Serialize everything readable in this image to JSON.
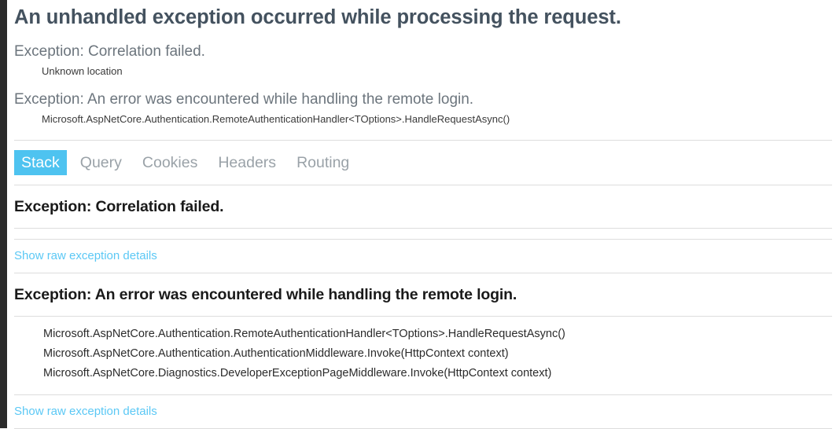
{
  "page": {
    "title": "An unhandled exception occurred while processing the request."
  },
  "header": {
    "summaries": [
      {
        "text": "Exception: Correlation failed.",
        "location": "Unknown location"
      },
      {
        "text": "Exception: An error was encountered while handling the remote login.",
        "location": "Microsoft.AspNetCore.Authentication.RemoteAuthenticationHandler<TOptions>.HandleRequestAsync()"
      }
    ]
  },
  "tabs": {
    "items": [
      {
        "label": "Stack",
        "active": true
      },
      {
        "label": "Query",
        "active": false
      },
      {
        "label": "Cookies",
        "active": false
      },
      {
        "label": "Headers",
        "active": false
      },
      {
        "label": "Routing",
        "active": false
      }
    ]
  },
  "stack": {
    "sections": [
      {
        "title": "Exception: Correlation failed.",
        "frames": [],
        "raw_details_label": "Show raw exception details"
      },
      {
        "title": "Exception: An error was encountered while handling the remote login.",
        "frames": [
          "Microsoft.AspNetCore.Authentication.RemoteAuthenticationHandler<TOptions>.HandleRequestAsync()",
          "Microsoft.AspNetCore.Authentication.AuthenticationMiddleware.Invoke(HttpContext context)",
          "Microsoft.AspNetCore.Diagnostics.DeveloperExceptionPageMiddleware.Invoke(HttpContext context)"
        ],
        "raw_details_label": "Show raw exception details"
      }
    ]
  },
  "colors": {
    "accent": "#4ec3f0",
    "link": "#5bc8f5",
    "title": "#44525f",
    "summary": "#6c757d",
    "rule": "#dddddd",
    "gutter": "#2b2b2b"
  }
}
